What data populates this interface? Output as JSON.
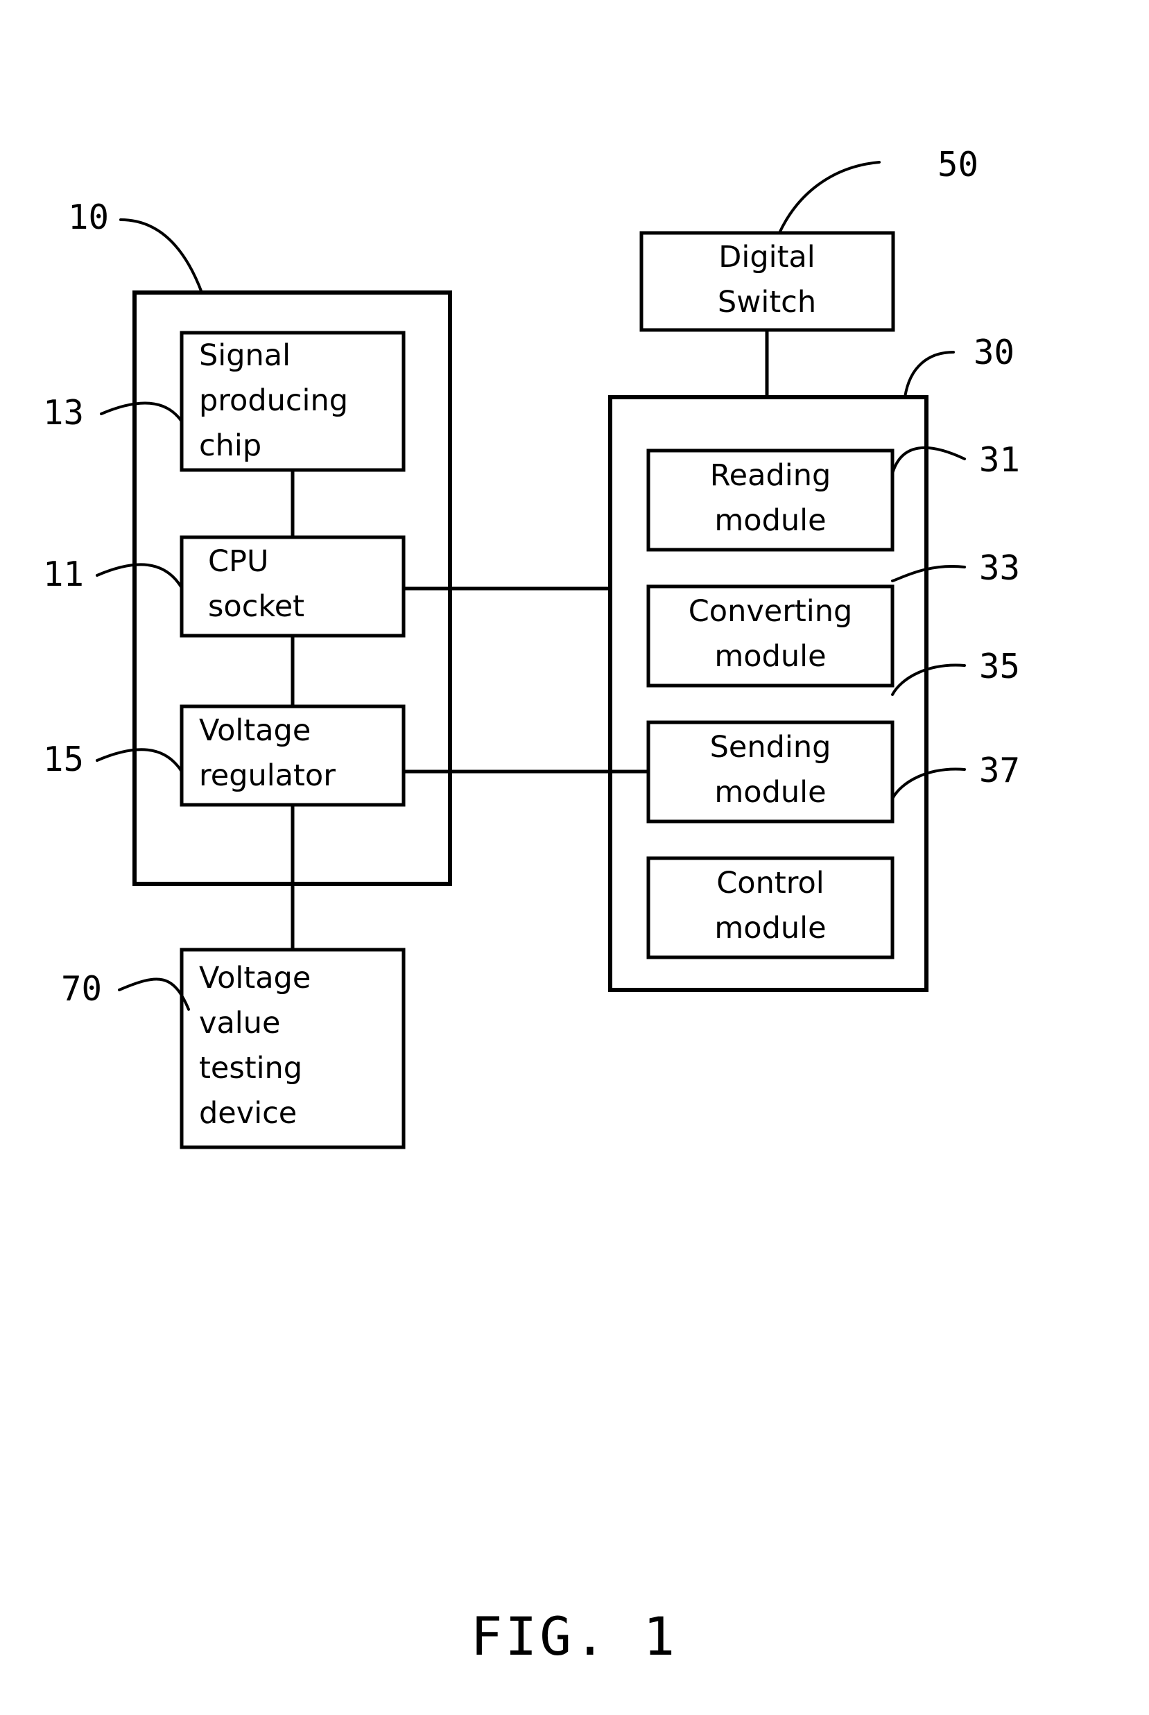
{
  "figure": {
    "caption": "FIG. 1",
    "background_color": "#ffffff",
    "line_color": "#000000"
  },
  "blocks": {
    "signal_producing_chip": {
      "label_lines": [
        "Signal",
        "producing",
        "chip"
      ],
      "ref": "13"
    },
    "cpu_socket": {
      "label_lines": [
        "CPU",
        "socket"
      ],
      "ref": "11"
    },
    "voltage_regulator": {
      "label_lines": [
        "Voltage",
        "regulator"
      ],
      "ref": "15"
    },
    "voltage_value_testing_device": {
      "label_lines": [
        "Voltage",
        "value",
        "testing",
        "device"
      ],
      "ref": "70"
    },
    "digital_switch": {
      "label_lines": [
        "Digital",
        "Switch"
      ],
      "ref": "50"
    },
    "reading_module": {
      "label_lines": [
        "Reading",
        "module"
      ],
      "ref": "31"
    },
    "converting_module": {
      "label_lines": [
        "Converting",
        "module"
      ],
      "ref": "33"
    },
    "sending_module": {
      "label_lines": [
        "Sending",
        "module"
      ],
      "ref": "35"
    },
    "control_module": {
      "label_lines": [
        "Control",
        "module"
      ],
      "ref": "37"
    },
    "left_enclosure": {
      "ref": "10"
    },
    "right_enclosure": {
      "ref": "30"
    }
  },
  "reference_numerals": {
    "n10": "10",
    "n11": "11",
    "n13": "13",
    "n15": "15",
    "n30": "30",
    "n31": "31",
    "n33": "33",
    "n35": "35",
    "n37": "37",
    "n50": "50",
    "n70": "70"
  }
}
